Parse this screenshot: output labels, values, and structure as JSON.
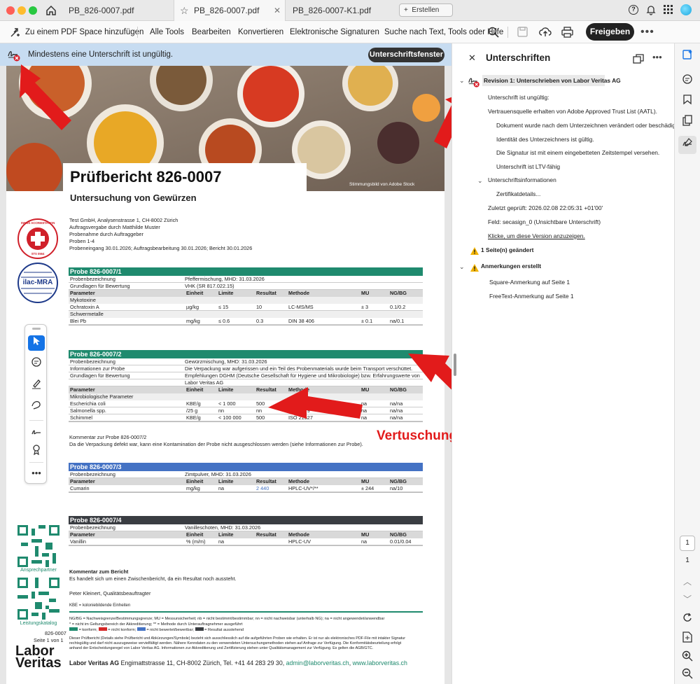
{
  "tabs": [
    {
      "label": "PB_826-0007.pdf"
    },
    {
      "label": "PB_826-0007.pdf"
    },
    {
      "label": "PB_826-0007-K1.pdf"
    }
  ],
  "new_tab_label": "Erstellen",
  "toolbar": {
    "pdf_space": "Zu einem PDF Space hinzufügen",
    "all_tools": "Alle Tools",
    "edit": "Bearbeiten",
    "convert": "Konvertieren",
    "esign": "Elektronische Signaturen",
    "search": "Suche nach Text, Tools oder Hilfe",
    "share": "Freigeben"
  },
  "banner": {
    "message": "Mindestens eine Unterschrift ist ungültig.",
    "button": "Unterschriftsfenster"
  },
  "doc": {
    "title": "Prüfbericht 826-0007",
    "subtitle": "Untersuchung von Gewürzen",
    "photo_credit": "Stimmungsbild von Adobe Stock",
    "address_lines": [
      "Test GmbH, Analysenstrasse 1, CH-8002 Zürich",
      "Auftragsvergabe durch Matthilde Muster",
      "Probenahme durch Auftraggeber",
      "Proben 1-4",
      "Probeneingang 30.01.2026; Auftragsbearbeitung 30.01.2026; Bericht 30.01.2026"
    ],
    "seal_text": "SWISS ACCREDITATION",
    "seal_id": "STS 0564",
    "ilac": "ilac-MRA",
    "annotation": "Vertuschung einer Nonkonformität",
    "qr1": "Ansprechpartner",
    "qr2": "Leistungskatalog",
    "doc_no": "826-0007",
    "page_of": "Seite 1 von 1",
    "logo_l1": "Labor",
    "logo_l2": "Veritas",
    "comment_head": "Kommentar zum Bericht",
    "comment_body": "Es handelt sich um einen Zwischenbericht, da ein Resultat noch aussteht.",
    "signer": "Peter Kleinert, Qualitätsbeauftragter",
    "kbe_note": "KBE = koloniebildende Einheiten",
    "legend1": "NG/BG = Nachweisgrenze/Bestimmungsgrenze; MU = Messunsicherheit; nb = nicht bestimmt/bestimmbar; nn = nicht nachweisbar (unterhalb NG); na = nicht angewendet/anwendbar",
    "legend2": "* = nicht im Geltungsbereich der Akkreditierung; ** = Methode durch Unterauftragnehmer ausgeführt",
    "legend3": "= konform;",
    "legend4": "= nicht konform;",
    "legend5": "= nicht bewertet/bewertbar;",
    "legend6": "= Resultat ausstehend",
    "disclaimer1": "Dieser Prüfbericht (Details siehe Prüfbericht und Abkürzungen/Symbole) bezieht sich ausschliesslich auf die aufgeführten Proben wie erhalten. Er ist nur als elektronisches PDF-File mit intakter Signatur",
    "disclaimer2": "rechtsgültig und darf nicht auszugsweise vervielfältigt werden. Nähere Kenndaten zu den verwendeten Untersuchungsmethoden stehen auf Anfrage zur Verfügung. Die Konformitätsbeurteilung erfolgt",
    "disclaimer3": "anhand der Entscheidungsregel von Labor Veritas AG. Informationen zur Akkreditierung und Zertifizierung stehen unter Qualitätsmanagement zur Verfügung. Es gelten die AGB/GTC.",
    "footer_name": "Labor Veritas AG",
    "footer_rest": " Engimattstrasse 11, CH-8002 Zürich, Tel. +41 44 283 29 30, ",
    "footer_mail": "admin@laborveritas.ch",
    "footer_sep": ", ",
    "footer_web": "www.laborveritas.ch"
  },
  "samples": [
    {
      "header": "Probe 826-0007/1",
      "color": "#1f8a6e",
      "info": [
        [
          "Probenbezeichnung",
          "Pfeffermischung, MHD: 31.03.2026"
        ],
        [
          "Grundlagen für Bewertung",
          "VHK (SR 817.022.15)"
        ]
      ],
      "cols": [
        "Parameter",
        "Einheit",
        "Limite",
        "Resultat",
        "Methode",
        "MU",
        "NG/BG"
      ],
      "rows": [
        {
          "group": "Mykotoxine"
        },
        [
          "Ochratoxin A",
          "µg/kg",
          "≤ 15",
          "10",
          "LC-MS/MS",
          "± 3",
          "0.1/0.2"
        ],
        {
          "group": "Schwermetalle"
        },
        [
          "Blei Pb",
          "mg/kg",
          "≤ 0.6",
          "0.3",
          "DIN 38 406",
          "± 0.1",
          "na/0.1"
        ]
      ]
    },
    {
      "header": "Probe 826-0007/2",
      "color": "#1f8a6e",
      "info": [
        [
          "Probenbezeichnung",
          "Gewürzmischung, MHD: 31.03.2026"
        ],
        [
          "Informationen zur Probe",
          "Die Verpackung war aufgerissen und ein Teil des Probenmaterials wurde beim Transport verschüttet."
        ],
        [
          "Grundlagen für Bewertung",
          "Empfehlungen DGHM (Deutsche Gesellschaft für Hygiene und Mikrobiologie) bzw. Erfahrungswerte von"
        ],
        [
          "",
          "Labor Veritas AG"
        ]
      ],
      "cols": [
        "Parameter",
        "Einheit",
        "Limite",
        "Resultat",
        "Methode",
        "MU",
        "NG/BG"
      ],
      "rows": [
        {
          "group": "Mikrobiologische Parameter"
        },
        [
          "Escherichia coli",
          "KBE/g",
          "< 1 000",
          "500",
          "ISO 16649-2",
          "na",
          "na/na"
        ],
        [
          "Salmonella spp.",
          "/25 g",
          "nn",
          "nn",
          "ISO 6579",
          "na",
          "na/na"
        ],
        [
          "Schimmel",
          "KBE/g",
          "< 100 000",
          "500",
          "ISO 21527",
          "na",
          "na/na"
        ]
      ],
      "comment1": "Kommentar zur Probe 826-0007/2",
      "comment2": "Da die Verpackung defekt war, kann eine Kontamination der Probe nicht ausgeschlossen werden (siehe Informationen zur Probe)."
    },
    {
      "header": "Probe 826-0007/3",
      "color": "#4472c4",
      "info": [
        [
          "Probenbezeichnung",
          "Zimtpulver, MHD: 31.03.2026"
        ]
      ],
      "cols": [
        "Parameter",
        "Einheit",
        "Limite",
        "Resultat",
        "Methode",
        "MU",
        "NG/BG"
      ],
      "rows": [
        [
          "Cumarin",
          "mg/kg",
          "na",
          "2 440",
          "HPLC-UV*/**",
          "± 244",
          "na/10"
        ]
      ]
    },
    {
      "header": "Probe 826-0007/4",
      "color": "#3a3d42",
      "info": [
        [
          "Probenbezeichnung",
          "Vanilleschoten, MHD: 31.03.2026"
        ]
      ],
      "cols": [
        "Parameter",
        "Einheit",
        "Limite",
        "Resultat",
        "Methode",
        "MU",
        "NG/BG"
      ],
      "rows": [
        [
          "Vanillin",
          "% (m/m)",
          "na",
          "",
          "HPLC-UV",
          "na",
          "0.01/0.04"
        ]
      ]
    }
  ],
  "panel": {
    "title": "Unterschriften",
    "revision": "Revision 1: Unterschrieben von Labor Veritas AG",
    "items": [
      "Unterschrift ist ungültig:",
      "Vertrauensquelle erhalten von Adobe Approved Trust List (AATL).",
      "Dokument wurde nach dem Unterzeichnen verändert oder beschädigt.",
      "Identität des Unterzeichners ist gültig.",
      "Die Signatur ist mit einem eingebetteten Zeitstempel versehen.",
      "Unterschrift ist LTV-fähig",
      "Unterschriftsinformationen",
      "Zertifikatdetails...",
      "Zuletzt geprüft: 2026.02.08 22:05:31 +01'00'",
      "Feld: secasign_0 (Unsichtbare Unterschrift)",
      "Klicke, um diese Version anzuzeigen."
    ],
    "changed": "1 Seite(n) geändert",
    "annotations": "Anmerkungen erstellt",
    "ann1": "Square-Anmerkung auf Seite 1",
    "ann2": "FreeText-Anmerkung auf Seite 1"
  },
  "rail": {
    "page_current": "1",
    "page_total": "1"
  },
  "colors": {
    "accent_red": "#e21b1b",
    "green": "#1f8a6e",
    "blue": "#4472c4",
    "dark": "#3a3d42"
  }
}
